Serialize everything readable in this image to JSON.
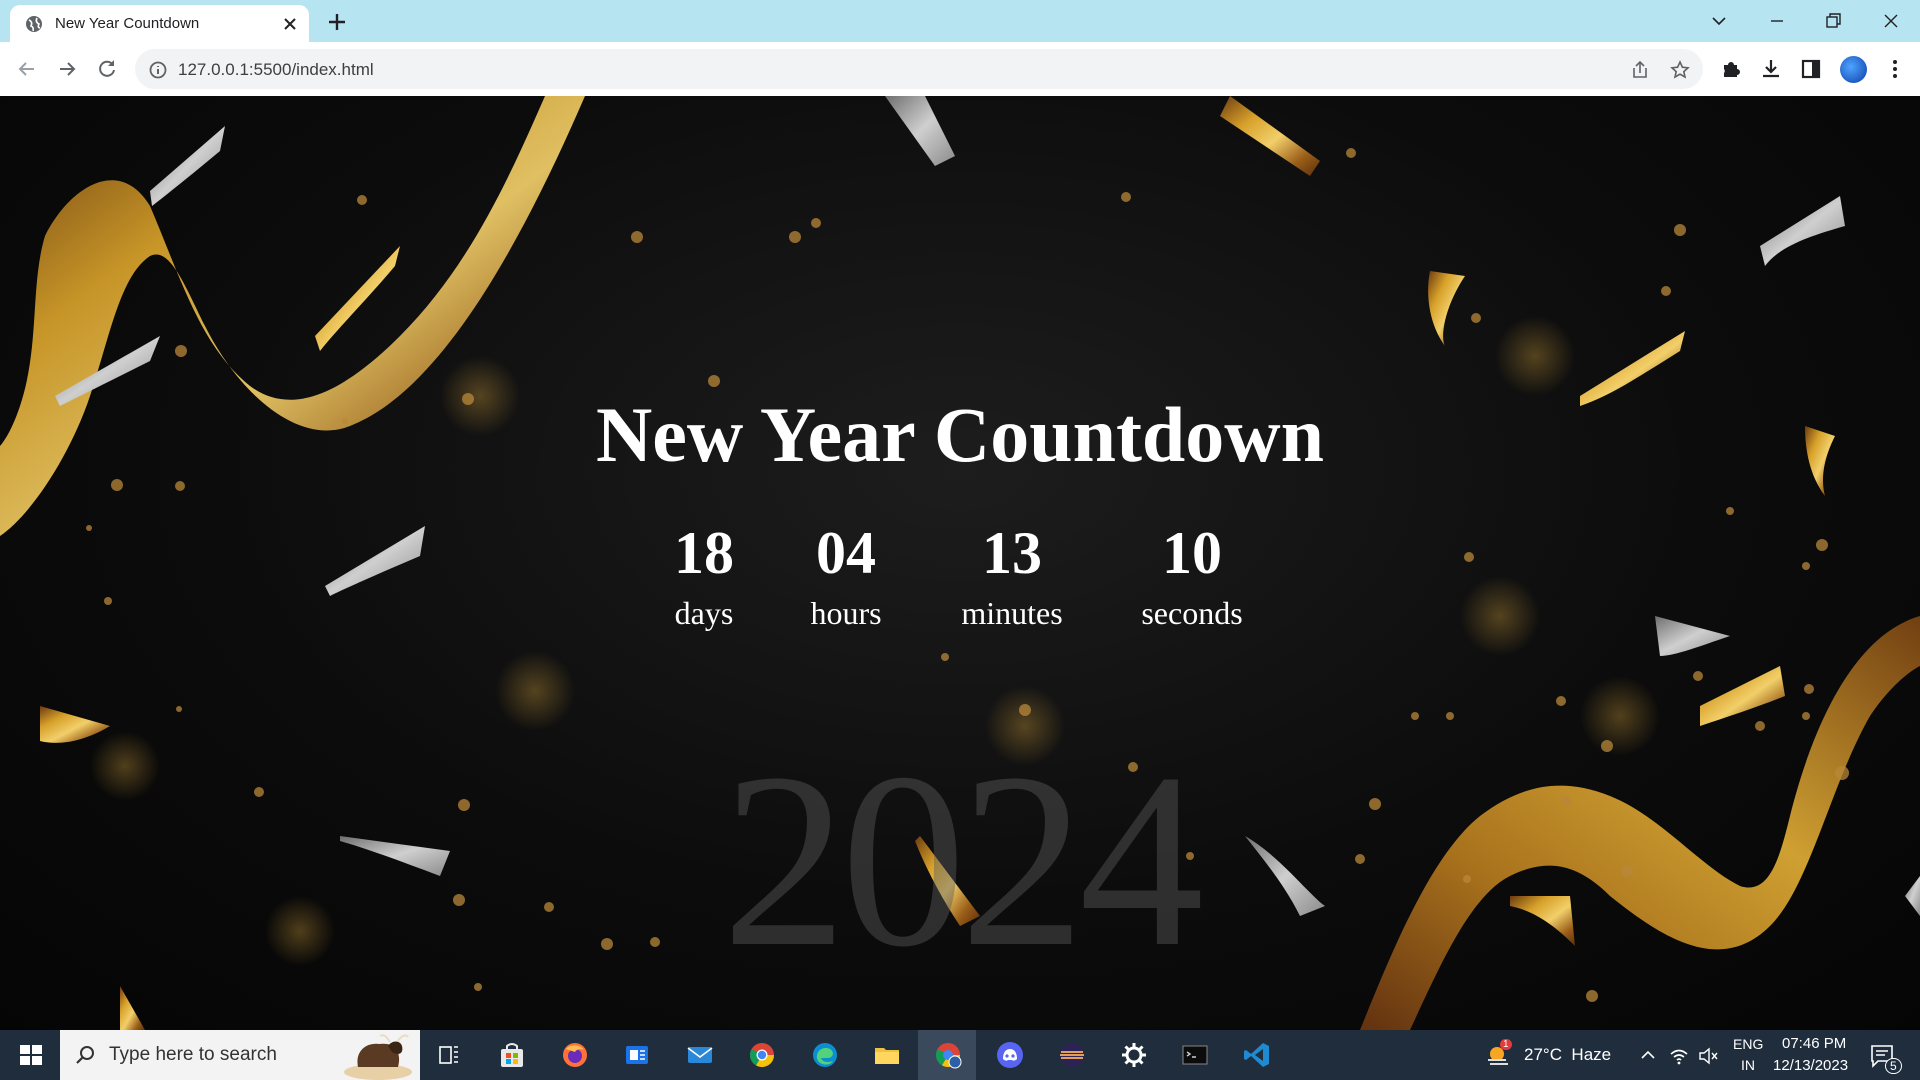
{
  "browser": {
    "tab_title": "New Year Countdown",
    "url": "127.0.0.1:5500/index.html"
  },
  "page": {
    "title": "New Year Countdown",
    "countdown": [
      {
        "value": "18",
        "label": "days"
      },
      {
        "value": "04",
        "label": "hours"
      },
      {
        "value": "13",
        "label": "minutes"
      },
      {
        "value": "10",
        "label": "seconds"
      }
    ],
    "year": "2024"
  },
  "taskbar": {
    "search_placeholder": "Type here to search",
    "weather": "27°C  Haze",
    "weather_badge": "1",
    "lang_top": "ENG",
    "lang_bottom": "IN",
    "time": "07:46 PM",
    "date": "12/13/2023",
    "notifications": "5",
    "apps": [
      "task-view",
      "microsoft-store",
      "firefox",
      "news",
      "mail",
      "chrome",
      "edge",
      "file-explorer",
      "chrome-profile",
      "discord",
      "eclipse",
      "settings",
      "terminal",
      "vscode"
    ]
  },
  "colors": {
    "tabstrip": "#b7e4f1",
    "taskbar": "#1f2d3d",
    "ribbon_gold": "#c9961f",
    "confetti_silver": "#a8a8a8"
  }
}
